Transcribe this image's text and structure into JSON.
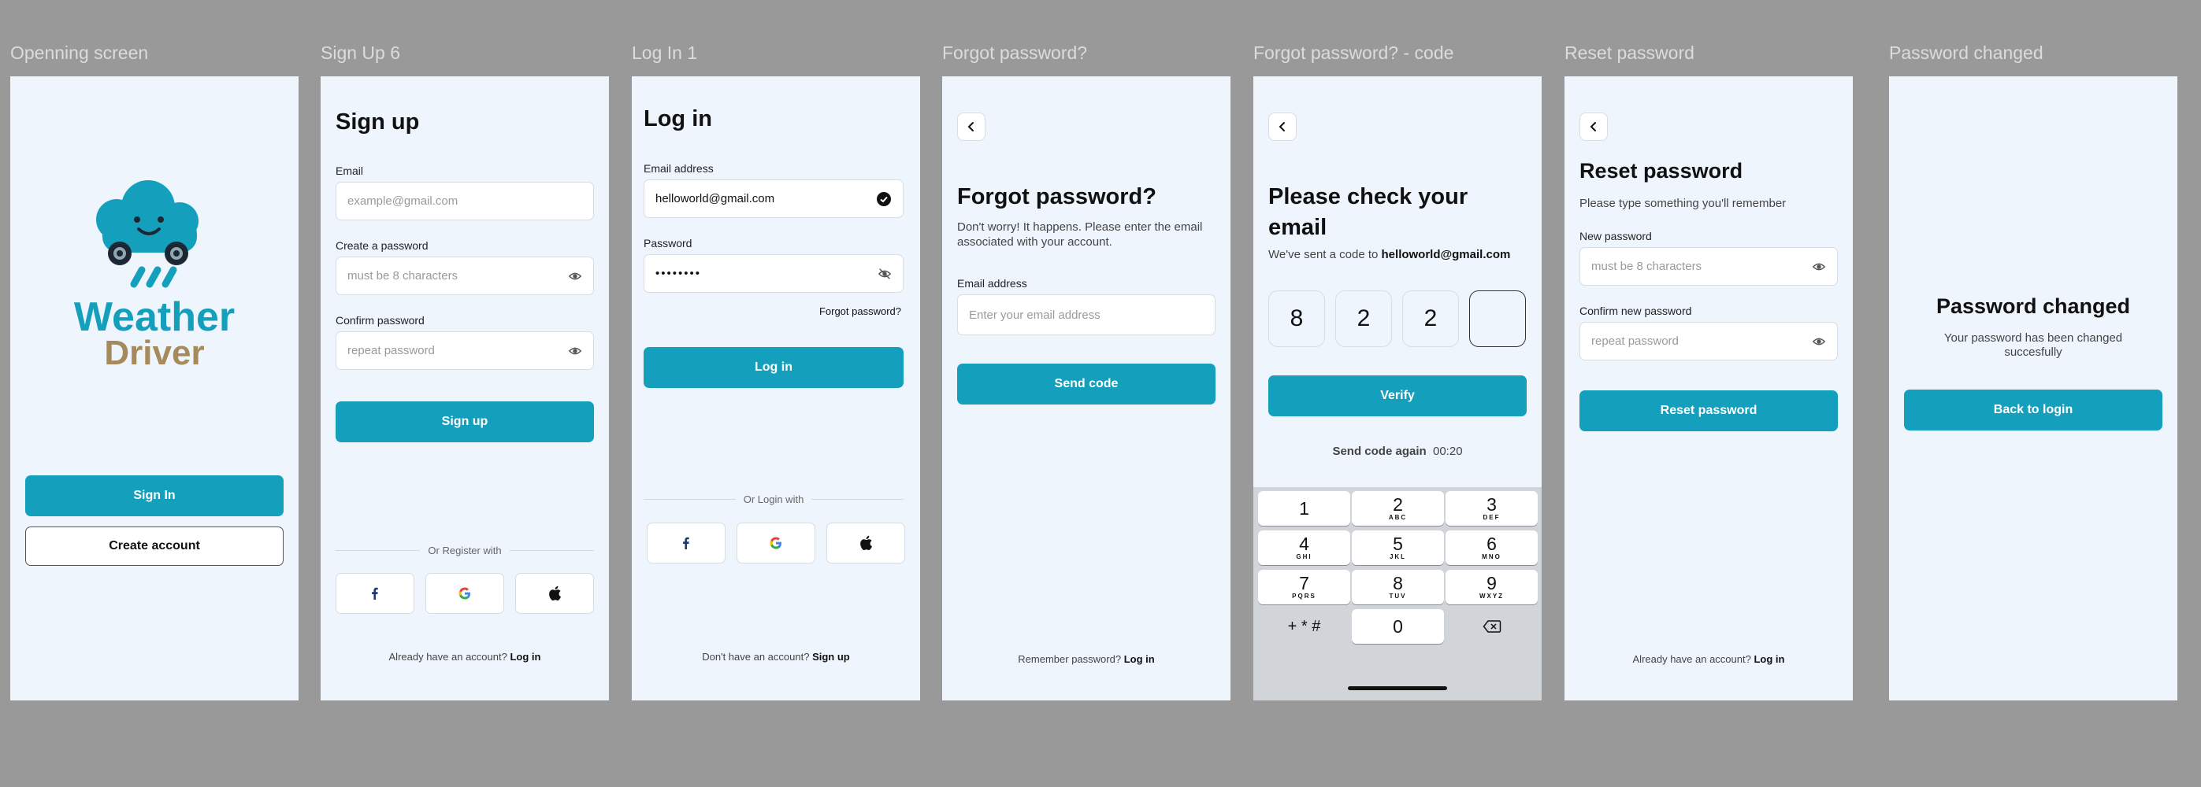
{
  "frames": {
    "opening": {
      "title": "Openning screen",
      "brand_line1": "Weather",
      "brand_line2": "Driver",
      "sign_in": "Sign In",
      "create_account": "Create account"
    },
    "signup": {
      "title": "Sign Up 6",
      "heading": "Sign up",
      "email_label": "Email",
      "email_placeholder": "example@gmail.com",
      "password_label": "Create a password",
      "password_placeholder": "must be 8 characters",
      "confirm_label": "Confirm password",
      "confirm_placeholder": "repeat password",
      "submit": "Sign up",
      "divider": "Or Register with",
      "footer_text": "Already have an account?",
      "footer_link": "Log in"
    },
    "login": {
      "title": "Log In 1",
      "heading": "Log in",
      "email_label": "Email address",
      "email_value": "helloworld@gmail.com",
      "password_label": "Password",
      "password_value": "••••••••",
      "forgot": "Forgot password?",
      "submit": "Log in",
      "divider": "Or Login with",
      "footer_text": "Don't have an account?",
      "footer_link": "Sign up"
    },
    "forgot": {
      "title": "Forgot password?",
      "heading": "Forgot password?",
      "description": "Don't worry! It happens. Please enter the email associated with your account.",
      "email_label": "Email address",
      "email_placeholder": "Enter your email address",
      "submit": "Send code",
      "footer_text": "Remember password?",
      "footer_link": "Log in"
    },
    "code": {
      "title": "Forgot password? - code",
      "heading": "Please check your email",
      "sent_text": "We've sent a code to",
      "sent_email": "helloworld@gmail.com",
      "digits": [
        "8",
        "2",
        "2",
        ""
      ],
      "submit": "Verify",
      "resend": "Send code again",
      "timer": "00:20",
      "keys": [
        {
          "n": "1",
          "l": ""
        },
        {
          "n": "2",
          "l": "ABC"
        },
        {
          "n": "3",
          "l": "DEF"
        },
        {
          "n": "4",
          "l": "GHI"
        },
        {
          "n": "5",
          "l": "JKL"
        },
        {
          "n": "6",
          "l": "MNO"
        },
        {
          "n": "7",
          "l": "PQRS"
        },
        {
          "n": "8",
          "l": "TUV"
        },
        {
          "n": "9",
          "l": "WXYZ"
        }
      ],
      "key_symbols": "+ * #",
      "key_zero": "0"
    },
    "reset": {
      "title": "Reset password",
      "heading": "Reset password",
      "subheading": "Please type something you'll remember",
      "new_label": "New password",
      "new_placeholder": "must be 8 characters",
      "confirm_label": "Confirm new password",
      "confirm_placeholder": "repeat password",
      "submit": "Reset password",
      "footer_text": "Already have an account?",
      "footer_link": "Log in"
    },
    "changed": {
      "title": "Password changed",
      "heading": "Password changed",
      "message": "Your password has been changed succesfully",
      "submit": "Back to login"
    }
  },
  "colors": {
    "primary": "#14a0bc",
    "screen_bg": "#eef5fd",
    "canvas_bg": "#999999",
    "brand_gold": "#a68a5b"
  },
  "icons": [
    "weather-driver-logo",
    "eye-icon",
    "eye-off-icon",
    "check-circle-icon",
    "chevron-left-icon",
    "facebook-icon",
    "google-icon",
    "apple-icon",
    "backspace-icon"
  ]
}
